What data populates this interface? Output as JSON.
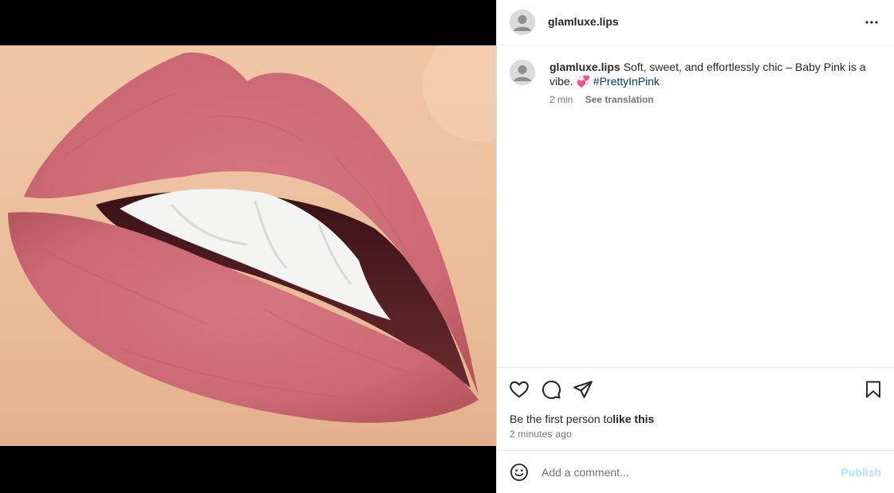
{
  "post": {
    "username": "glamluxe.lips",
    "image_description_icon": "lips-photo"
  },
  "caption": {
    "username": "glamluxe.lips",
    "text": "Soft, sweet, and effortlessly chic – Baby Pink is a vibe.",
    "emoji": "💞",
    "hashtag": "#PrettyInPink",
    "time": "2 min",
    "translation_link": "See translation"
  },
  "actions": {
    "icons": [
      "heart-icon",
      "comment-icon",
      "share-icon",
      "bookmark-icon"
    ],
    "likes_prefix": "Be the first person to",
    "likes_link": "like this",
    "timestamp": "2 minutes ago"
  },
  "comment": {
    "placeholder": "Add a comment...",
    "publish_label": "Publish",
    "emoji_icon": "smiley-icon"
  },
  "colors": {
    "lip": "#cf6c77",
    "skin": "#efc3a2",
    "hashtag": "#00376b",
    "publish_disabled": "#b2dffc"
  }
}
